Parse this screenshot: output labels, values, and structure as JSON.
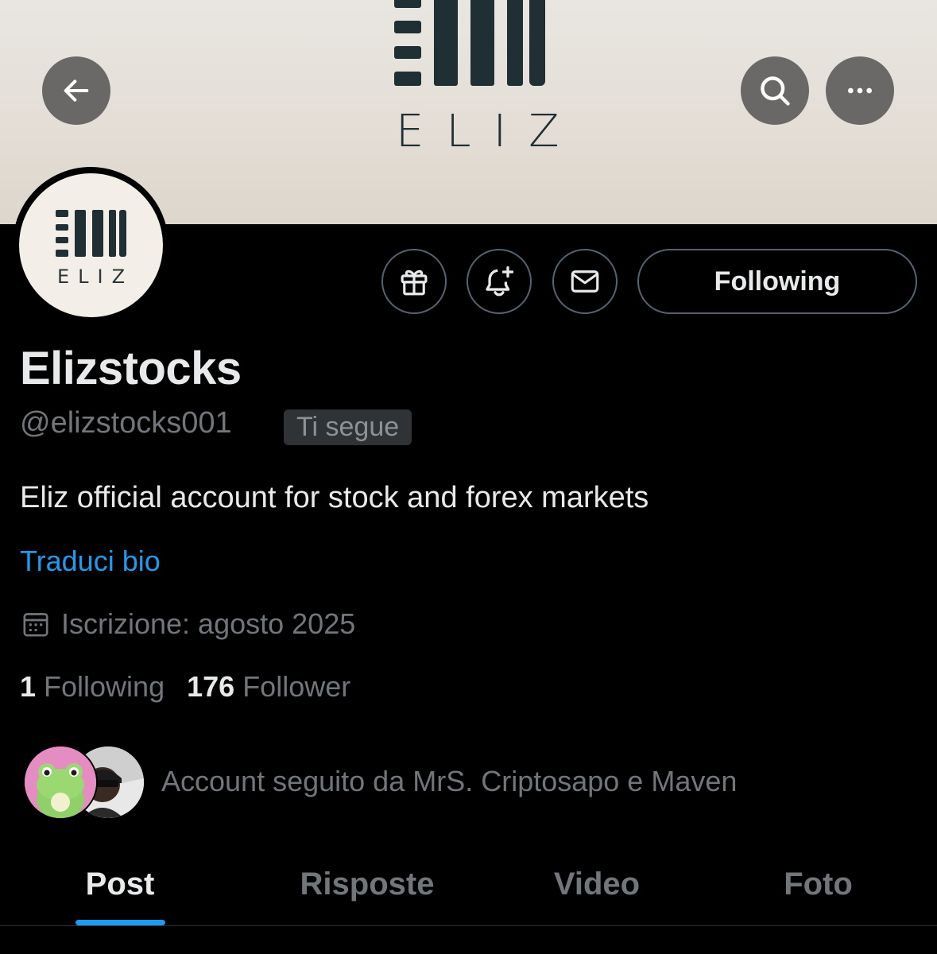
{
  "banner": {
    "logo_text": "ELIZ",
    "back_icon": "arrow-left-icon",
    "search_icon": "search-icon",
    "more_icon": "more-horizontal-icon"
  },
  "avatar": {
    "logo_text": "ELIZ"
  },
  "actions": {
    "gift_icon": "gift-icon",
    "notify_icon": "bell-plus-icon",
    "message_icon": "envelope-icon",
    "following_label": "Following"
  },
  "profile": {
    "name": "Elizstocks",
    "handle": "@elizstocks001",
    "follows_you": "Ti segue",
    "bio": "Eliz official account for stock and forex markets",
    "translate_bio": "Traduci bio",
    "joined": "Iscrizione: agosto 2025",
    "following_count": "1",
    "following_label": "Following",
    "followers_count": "176",
    "followers_label": "Follower",
    "followed_by": "Account seguito da MrS. Criptosapo e Maven"
  },
  "tabs": [
    {
      "label": "Post",
      "active": true
    },
    {
      "label": "Risposte",
      "active": false
    },
    {
      "label": "Video",
      "active": false
    },
    {
      "label": "Foto",
      "active": false
    }
  ],
  "colors": {
    "background": "#000000",
    "accent": "#1d9bf0",
    "text_primary": "#e7e9ea",
    "text_secondary": "#71767b",
    "border": "#536471",
    "logo_dark": "#1f2f33"
  }
}
